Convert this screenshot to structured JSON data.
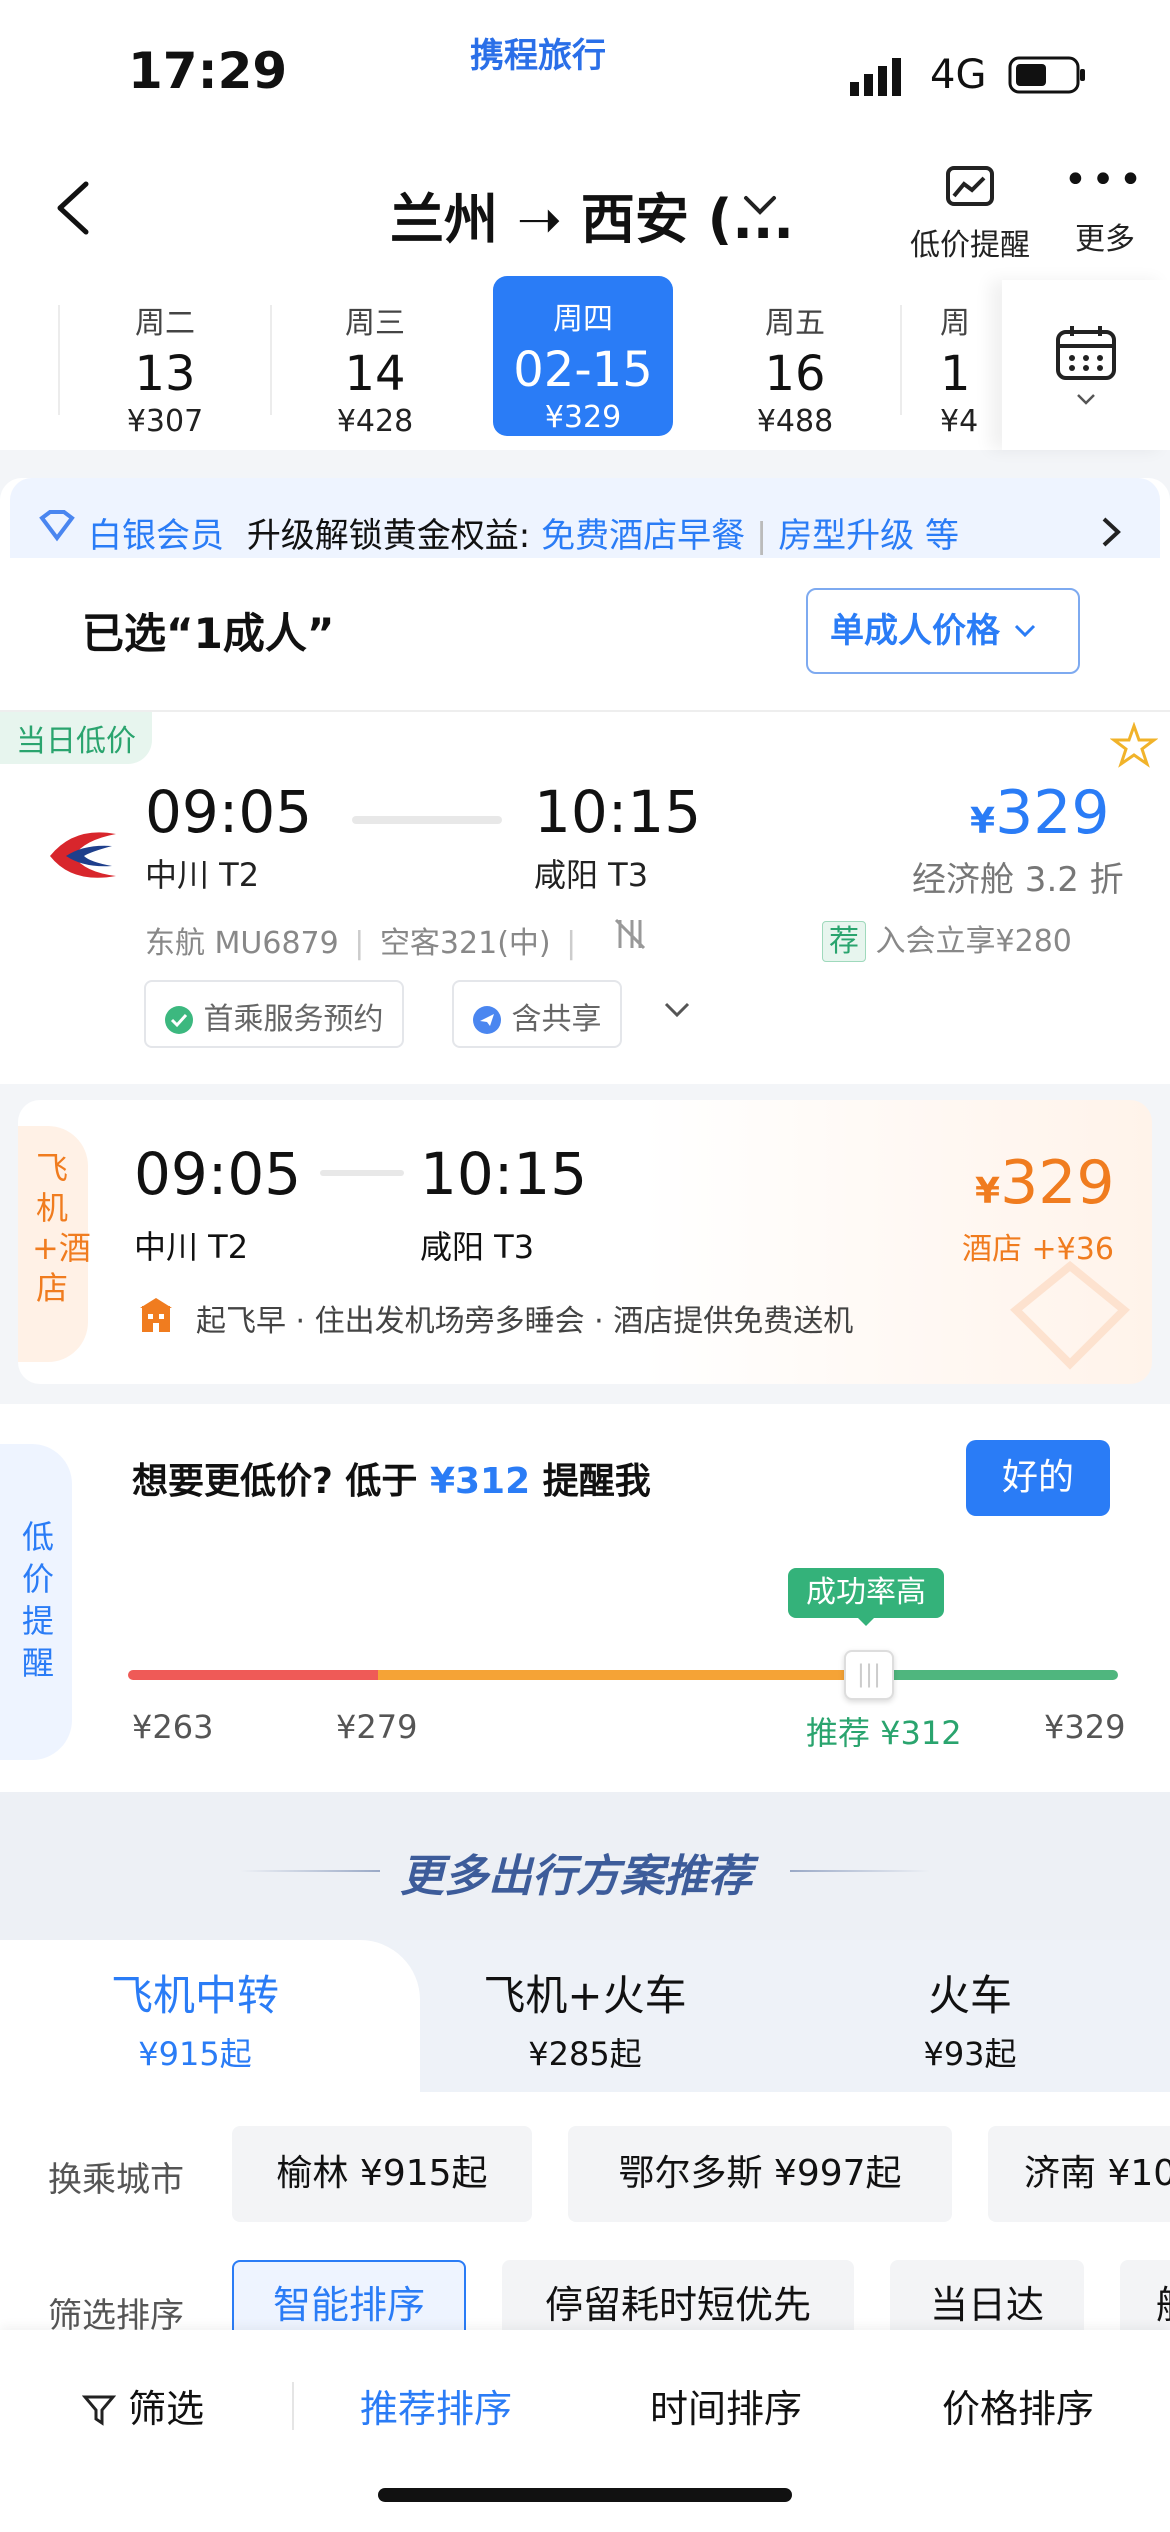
{
  "status": {
    "time": "17:29",
    "brand": "携程旅行",
    "network": "4G"
  },
  "header": {
    "route": "兰州 ➝ 西安 (...",
    "alert_label": "低价提醒",
    "more_label": "更多"
  },
  "dates": [
    {
      "weekday": "周二",
      "day": "13",
      "price": "¥307"
    },
    {
      "weekday": "周三",
      "day": "14",
      "price": "¥428"
    },
    {
      "weekday": "周四",
      "day": "02-15",
      "price": "¥329",
      "selected": true
    },
    {
      "weekday": "周五",
      "day": "16",
      "price": "¥488"
    },
    {
      "weekday": "周",
      "day": "1",
      "price": "¥4"
    }
  ],
  "member": {
    "level": "白银会员",
    "text": "升级解锁黄金权益:",
    "benefit1": "免费酒店早餐",
    "benefit2": "房型升级",
    "suffix": "等"
  },
  "passenger": {
    "selected": "已选“1成人”",
    "price_mode": "单成人价格"
  },
  "flight": {
    "tag": "当日低价",
    "dep_time": "09:05",
    "arr_time": "10:15",
    "dep_airport": "中川 T2",
    "arr_airport": "咸阳 T3",
    "price_symbol": "¥",
    "price": "329",
    "cabin": "经济舱 3.2 折",
    "airline": "东航 MU6879",
    "aircraft": "空客321(中)",
    "rec_tag": "荐",
    "member_price": "入会立享¥280",
    "service1": "首乘服务预约",
    "service2": "含共享"
  },
  "combo": {
    "side_label": "飞机+酒店",
    "dep_time": "09:05",
    "arr_time": "10:15",
    "dep_airport": "中川 T2",
    "arr_airport": "咸阳 T3",
    "price_symbol": "¥",
    "price": "329",
    "hotel_extra": "酒店 +¥36",
    "desc": "起飞早 · 住出发机场旁多睡会 · 酒店提供免费送机"
  },
  "alert": {
    "side_label": "低价提醒",
    "title_prefix": "想要更低价? 低于 ",
    "threshold": "¥312",
    "title_suffix": " 提醒我",
    "ok": "好的",
    "tooltip": "成功率高",
    "ticks": [
      "¥263",
      "¥279",
      "推荐 ¥312",
      "¥329"
    ]
  },
  "more": {
    "title": "更多出行方案推荐",
    "tabs": [
      {
        "label": "飞机中转",
        "price": "¥915起"
      },
      {
        "label": "飞机+火车",
        "price": "¥285起"
      },
      {
        "label": "火车",
        "price": "¥93起"
      }
    ],
    "transfer_label": "换乘城市",
    "cities": [
      "榆林 ¥915起",
      "鄂尔多斯 ¥997起",
      "济南 ¥10"
    ],
    "sort_label": "筛选排序",
    "sorts": [
      "智能排序",
      "停留耗时短优先",
      "当日达",
      "舱"
    ]
  },
  "bottom": {
    "filter": "筛选",
    "recommend": "推荐排序",
    "time": "时间排序",
    "price": "价格排序"
  }
}
